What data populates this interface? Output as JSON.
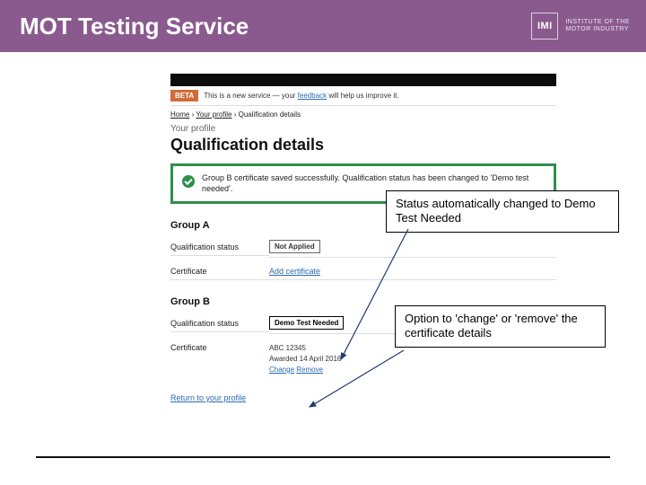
{
  "header": {
    "title": "MOT Testing Service",
    "brand_short": "IMI",
    "brand_long_1": "INSTITUTE OF THE",
    "brand_long_2": "MOTOR INDUSTRY"
  },
  "beta": {
    "badge": "BETA",
    "text": "This is a new service — your ",
    "feedback": "feedback",
    "tail": " will help us improve it."
  },
  "breadcrumbs": {
    "home": "Home",
    "profile": "Your profile",
    "current": "Qualification details"
  },
  "page": {
    "section_label": "Your profile",
    "title": "Qualification details"
  },
  "banner": {
    "text": "Group B certificate saved successfully. Qualification status has been changed to 'Demo test needed'."
  },
  "groupA": {
    "title": "Group A",
    "status_label": "Qualification status",
    "status_value": "Not Applied",
    "cert_label": "Certificate",
    "cert_link": "Add certificate"
  },
  "groupB": {
    "title": "Group B",
    "status_label": "Qualification status",
    "status_value": "Demo Test Needed",
    "cert_label": "Certificate",
    "cert_number": "ABC 12345",
    "cert_awarded": "Awarded 14 April 2016",
    "change": "Change",
    "remove": "Remove"
  },
  "return_link": "Return to your profile",
  "callouts": {
    "top": "Status automatically changed to Demo Test Needed",
    "mid": "Option to 'change' or 'remove' the certificate details"
  }
}
